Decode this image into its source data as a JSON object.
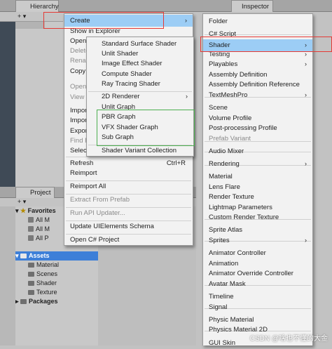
{
  "hierarchy": {
    "tab_label": "Hierarchy",
    "plus_label": "+ ▾",
    "scene_item": "Sa"
  },
  "inspector": {
    "tab_label": "Inspector"
  },
  "project": {
    "tab_label": "Project",
    "plus_label": "+ ▾",
    "favorites": "Favorites",
    "fav_items": [
      "All M",
      "All M",
      "All P"
    ],
    "assets": "Assets",
    "asset_folders": [
      "Material",
      "Scenes",
      "Shader",
      "Texture"
    ],
    "packages": "Packages"
  },
  "context_menu": {
    "create": "Create",
    "show_in_explorer": "Show in Explorer",
    "open": "Open",
    "delete": "Delete",
    "rename": "Rename",
    "copy_path": "Copy Path",
    "open_scene_additive": "Open Scene Additive",
    "view_in": "View in Package Manager",
    "import_new_asset": "Import New Asset...",
    "import_package": "Import Package",
    "export_package": "Export Package...",
    "find_references": "Find References In Scene",
    "select_dependencies": "Select Dependencies",
    "refresh": "Refresh",
    "refresh_shortcut": "Ctrl+R",
    "reimport": "Reimport",
    "reimport_all": "Reimport All",
    "extract_from_prefab": "Extract From Prefab",
    "run_api_updater": "Run API Updater...",
    "update_uielements": "Update UIElements Schema",
    "open_csharp_project": "Open C# Project"
  },
  "shader_menu": {
    "items": [
      "Standard Surface Shader",
      "Unlit Shader",
      "Image Effect Shader",
      "Compute Shader",
      "Ray Tracing Shader"
    ],
    "renderer_2d": "2D Renderer",
    "unlit_graph": "Unlit Graph",
    "graphs": [
      "PBR Graph",
      "VFX Shader Graph",
      "Sub Graph"
    ],
    "variant_collection": "Shader Variant Collection"
  },
  "create_menu": {
    "items": [
      {
        "label": "Folder",
        "arrow": false,
        "disabled": false
      },
      {
        "label": "C# Script",
        "arrow": false,
        "disabled": false
      },
      {
        "label": "Shader",
        "arrow": true,
        "disabled": false
      },
      {
        "label": "Testing",
        "arrow": true,
        "disabled": false
      },
      {
        "label": "Playables",
        "arrow": true,
        "disabled": false
      },
      {
        "label": "Assembly Definition",
        "arrow": false,
        "disabled": false
      },
      {
        "label": "Assembly Definition Reference",
        "arrow": false,
        "disabled": false
      },
      {
        "label": "TextMeshPro",
        "arrow": true,
        "disabled": false
      },
      {
        "label": "Scene",
        "arrow": false,
        "disabled": false
      },
      {
        "label": "Volume Profile",
        "arrow": false,
        "disabled": false
      },
      {
        "label": "Post-processing Profile",
        "arrow": false,
        "disabled": false
      },
      {
        "label": "Prefab Variant",
        "arrow": false,
        "disabled": true
      },
      {
        "label": "Audio Mixer",
        "arrow": false,
        "disabled": false
      },
      {
        "label": "Rendering",
        "arrow": true,
        "disabled": false
      },
      {
        "label": "Material",
        "arrow": false,
        "disabled": false
      },
      {
        "label": "Lens Flare",
        "arrow": false,
        "disabled": false
      },
      {
        "label": "Render Texture",
        "arrow": false,
        "disabled": false
      },
      {
        "label": "Lightmap Parameters",
        "arrow": false,
        "disabled": false
      },
      {
        "label": "Custom Render Texture",
        "arrow": false,
        "disabled": false
      },
      {
        "label": "Sprite Atlas",
        "arrow": false,
        "disabled": false
      },
      {
        "label": "Sprites",
        "arrow": true,
        "disabled": false
      },
      {
        "label": "Animator Controller",
        "arrow": false,
        "disabled": false
      },
      {
        "label": "Animation",
        "arrow": false,
        "disabled": false
      },
      {
        "label": "Animator Override Controller",
        "arrow": false,
        "disabled": false
      },
      {
        "label": "Avatar Mask",
        "arrow": false,
        "disabled": false
      },
      {
        "label": "Timeline",
        "arrow": false,
        "disabled": false
      },
      {
        "label": "Signal",
        "arrow": false,
        "disabled": false
      },
      {
        "label": "Physic Material",
        "arrow": false,
        "disabled": false
      },
      {
        "label": "Physics Material 2D",
        "arrow": false,
        "disabled": false
      },
      {
        "label": "GUI Skin",
        "arrow": false,
        "disabled": false
      }
    ]
  },
  "watermark": "CSDN @啥也不懂的大金",
  "colors": {
    "highlight": "#9ccdf5",
    "red_box": "#e53935",
    "green_box": "#4caf50"
  }
}
